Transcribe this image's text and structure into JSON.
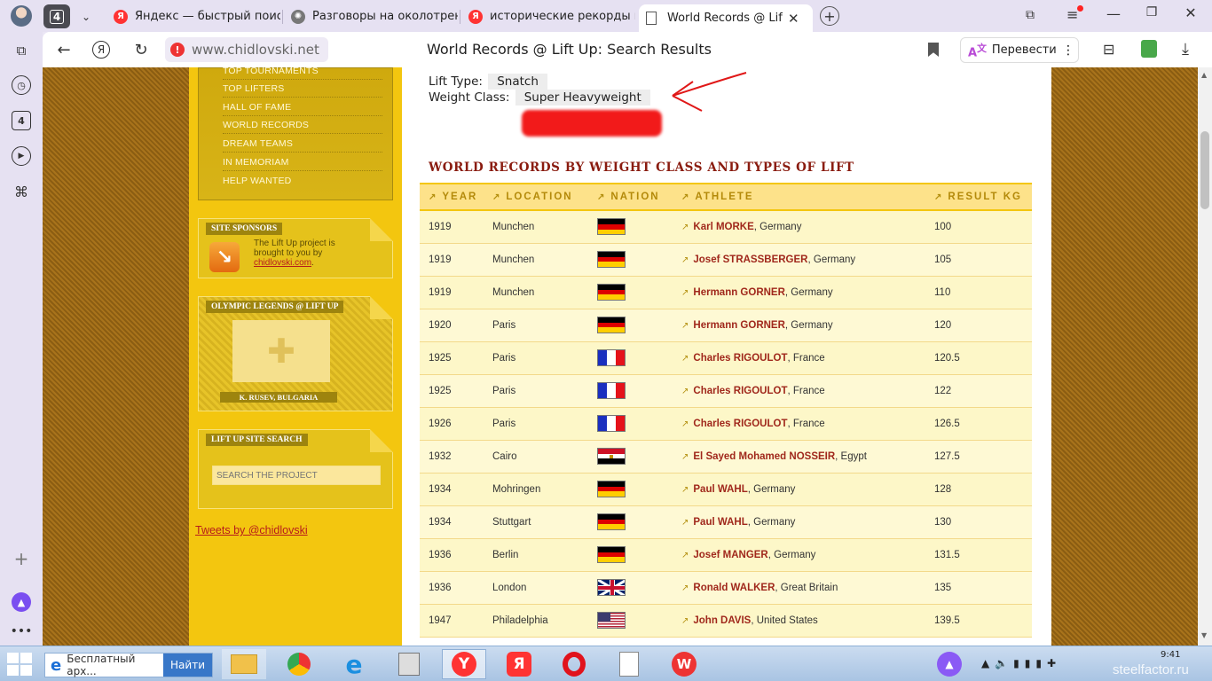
{
  "browser": {
    "tab_count": "4",
    "tabs": [
      {
        "title": "Яндекс — быстрый поиск"
      },
      {
        "title": "Разговоры на околотрен"
      },
      {
        "title": "исторические рекорды м"
      },
      {
        "title": "World Records @ Lift U"
      }
    ],
    "url": "www.chidlovski.net",
    "page_title": "World Records @ Lift Up: Search Results",
    "translate_label": "Перевести"
  },
  "sidebar": {
    "menu": [
      "TOP TOURNAMENTS",
      "TOP LIFTERS",
      "HALL OF FAME",
      "WORLD RECORDS",
      "DREAM TEAMS",
      "IN MEMORIAM",
      "HELP WANTED"
    ],
    "sponsors_title": "SITE SPONSORS",
    "sponsors_text": "The Lift Up project is brought to you by",
    "sponsors_link": "chidlovski.com",
    "sponsors_end": ".",
    "legends_title": "OLYMPIC LEGENDS @ LIFT UP",
    "legends_caption": "K. RUSEV, BULGARIA",
    "search_title": "LIFT UP SITE SEARCH",
    "search_placeholder": "SEARCH THE PROJECT",
    "tweets": "Tweets by @chidlovski"
  },
  "filters": {
    "lift_type_label": "Lift Type:",
    "lift_type": "Snatch",
    "weight_class_label": "Weight Class:",
    "weight_class": "Super Heavyweight"
  },
  "section_title": "WORLD RECORDS BY WEIGHT CLASS AND TYPES OF LIFT",
  "columns": [
    "YEAR",
    "LOCATION",
    "NATION",
    "ATHLETE",
    "RESULT KG"
  ],
  "records": [
    {
      "year": "1919",
      "location": "Munchen",
      "flag": "de",
      "athlete": "Karl MORKE",
      "country": ", Germany",
      "result": "100"
    },
    {
      "year": "1919",
      "location": "Munchen",
      "flag": "de",
      "athlete": "Josef STRASSBERGER",
      "country": ", Germany",
      "result": "105"
    },
    {
      "year": "1919",
      "location": "Munchen",
      "flag": "de",
      "athlete": "Hermann GORNER",
      "country": ", Germany",
      "result": "110"
    },
    {
      "year": "1920",
      "location": "Paris",
      "flag": "de",
      "athlete": "Hermann GORNER",
      "country": ", Germany",
      "result": "120"
    },
    {
      "year": "1925",
      "location": "Paris",
      "flag": "fr",
      "athlete": "Charles RIGOULOT",
      "country": ", France",
      "result": "120.5"
    },
    {
      "year": "1925",
      "location": "Paris",
      "flag": "fr",
      "athlete": "Charles RIGOULOT",
      "country": ", France",
      "result": "122"
    },
    {
      "year": "1926",
      "location": "Paris",
      "flag": "fr",
      "athlete": "Charles RIGOULOT",
      "country": ", France",
      "result": "126.5"
    },
    {
      "year": "1932",
      "location": "Cairo",
      "flag": "eg",
      "athlete": "El Sayed Mohamed NOSSEIR",
      "country": ", Egypt",
      "result": "127.5"
    },
    {
      "year": "1934",
      "location": "Mohringen",
      "flag": "de",
      "athlete": "Paul WAHL",
      "country": ", Germany",
      "result": "128"
    },
    {
      "year": "1934",
      "location": "Stuttgart",
      "flag": "de",
      "athlete": "Paul WAHL",
      "country": ", Germany",
      "result": "130"
    },
    {
      "year": "1936",
      "location": "Berlin",
      "flag": "de",
      "athlete": "Josef MANGER",
      "country": ", Germany",
      "result": "131.5"
    },
    {
      "year": "1936",
      "location": "London",
      "flag": "gb",
      "athlete": "Ronald WALKER",
      "country": ", Great Britain",
      "result": "135"
    },
    {
      "year": "1947",
      "location": "Philadelphia",
      "flag": "us",
      "athlete": "John DAVIS",
      "country": ", United States",
      "result": "139.5"
    }
  ],
  "taskbar": {
    "search_text": "Бесплатный арх...",
    "search_button": "Найти",
    "time": "9:41",
    "watermark": "steelfactor.ru"
  }
}
